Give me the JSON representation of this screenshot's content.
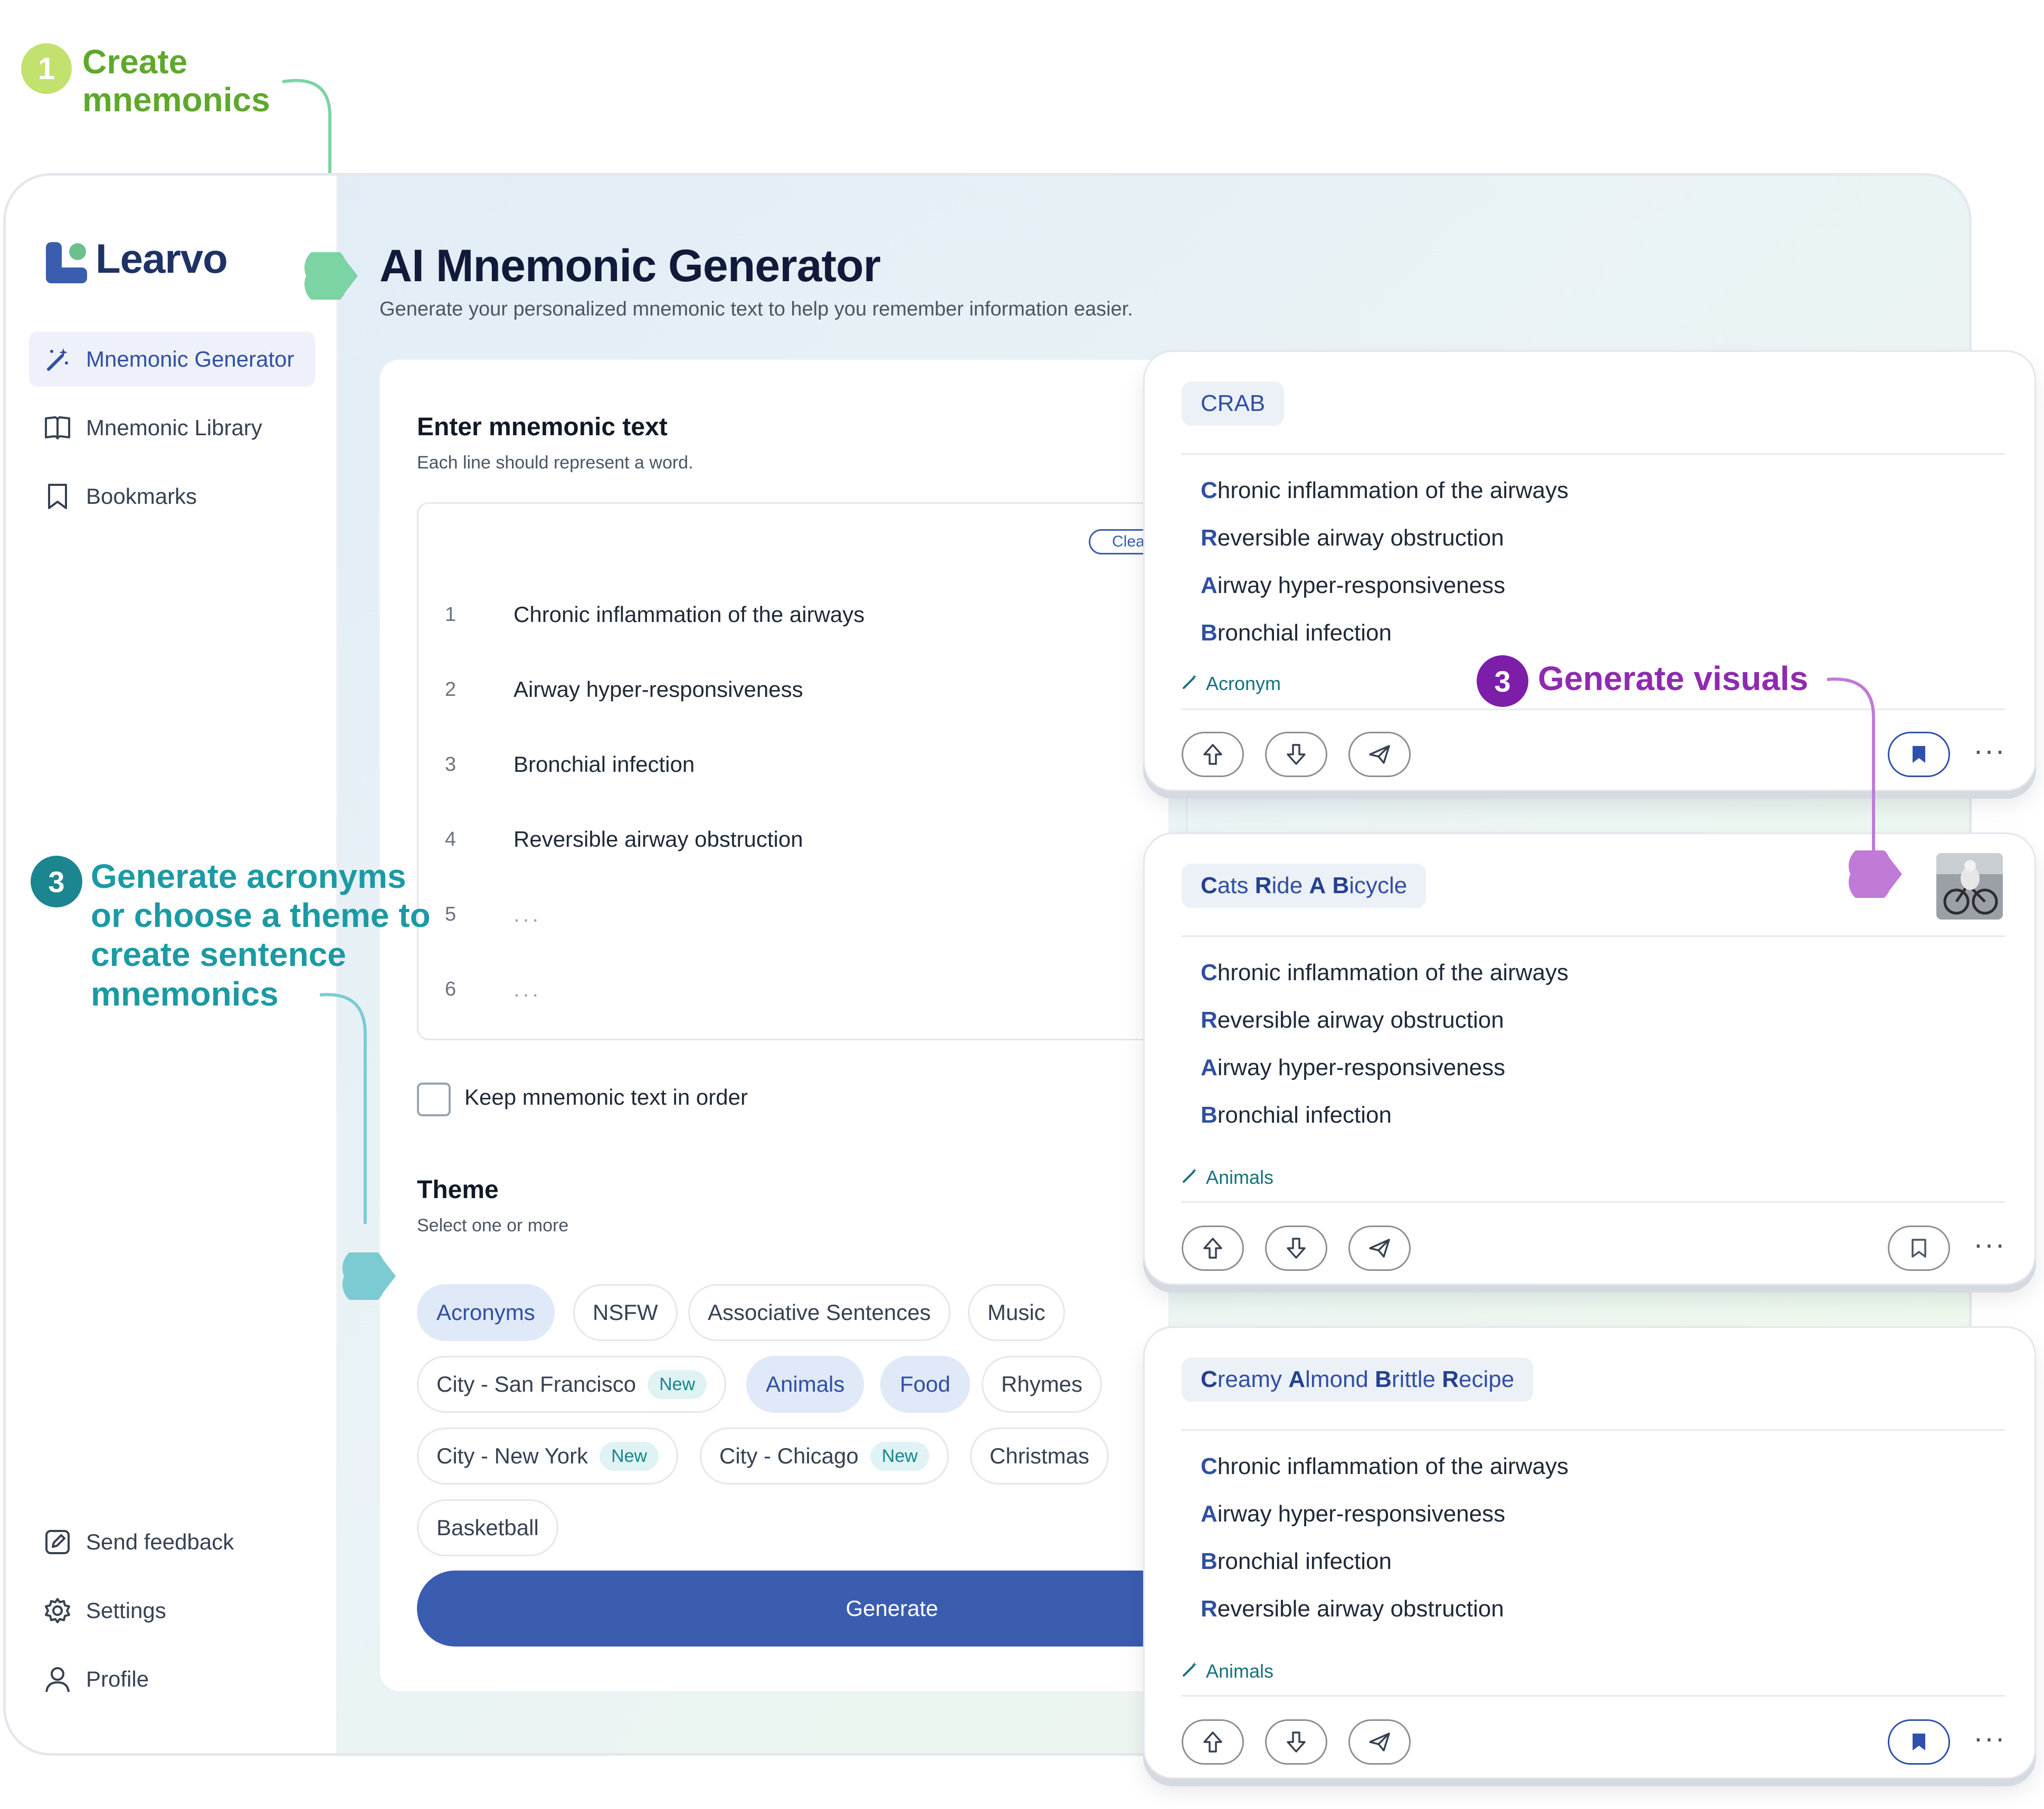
{
  "annotations": {
    "create": {
      "number": "1",
      "text": "Create\nmnemonics",
      "color": "#5fa82c",
      "badge_color": "#c2e16f"
    },
    "acronyms": {
      "number": "3",
      "text": "Generate acronyms\nor choose a theme to\ncreate sentence\nmnemonics",
      "color": "#1c9aa3",
      "badge_color": "#1c8690"
    },
    "visuals": {
      "number": "3",
      "text": "Generate visuals",
      "color": "#8f2ab0",
      "badge_color": "#7c1ea8"
    }
  },
  "brand": {
    "name": "Learvo",
    "accent": "#3b5db0"
  },
  "sidebar": {
    "items": [
      {
        "label": "Mnemonic Generator",
        "icon": "magic-wand-icon",
        "active": true
      },
      {
        "label": "Mnemonic Library",
        "icon": "book-icon",
        "active": false
      },
      {
        "label": "Bookmarks",
        "icon": "bookmark-icon",
        "active": false
      }
    ],
    "bottom": [
      {
        "label": "Send feedback",
        "icon": "edit-icon"
      },
      {
        "label": "Settings",
        "icon": "gear-icon"
      },
      {
        "label": "Profile",
        "icon": "user-icon"
      }
    ]
  },
  "page": {
    "title": "AI Mnemonic Generator",
    "subtitle": "Generate your personalized mnemonic text to help you remember information easier."
  },
  "form": {
    "input_title": "Enter mnemonic text",
    "input_sub": "Each line should represent a word.",
    "clear_label": "Clear",
    "lines": [
      {
        "no": "1",
        "text": "Chronic inflammation of the airways"
      },
      {
        "no": "2",
        "text": "Airway hyper-responsiveness"
      },
      {
        "no": "3",
        "text": "Bronchial infection"
      },
      {
        "no": "4",
        "text": "Reversible airway obstruction"
      },
      {
        "no": "5",
        "text": "..."
      },
      {
        "no": "6",
        "text": "..."
      }
    ],
    "keep_order_label": "Keep mnemonic text in order",
    "theme_title": "Theme",
    "theme_sub": "Select one or more",
    "new_badge": "New",
    "chips": [
      {
        "label": "Acronyms",
        "selected": true
      },
      {
        "label": "NSFW",
        "selected": false
      },
      {
        "label": "Associative Sentences",
        "selected": false
      },
      {
        "label": "Music",
        "selected": false
      },
      {
        "label": "City - San Francisco",
        "selected": false,
        "new": true
      },
      {
        "label": "Animals",
        "selected": true
      },
      {
        "label": "Food",
        "selected": true
      },
      {
        "label": "Rhymes",
        "selected": false
      },
      {
        "label": "City - New York",
        "selected": false,
        "new": true
      },
      {
        "label": "City - Chicago",
        "selected": false,
        "new": true
      },
      {
        "label": "Christmas",
        "selected": false
      },
      {
        "label": "Basketball",
        "selected": false
      }
    ],
    "generate_label": "Generate"
  },
  "results": [
    {
      "title_parts": [
        {
          "b": "",
          "r": "CRAB"
        }
      ],
      "lines": [
        {
          "first": "C",
          "rest": "hronic inflammation of the airways"
        },
        {
          "first": "R",
          "rest": "eversible airway obstruction"
        },
        {
          "first": "A",
          "rest": "irway hyper-responsiveness"
        },
        {
          "first": "B",
          "rest": "ronchial infection"
        }
      ],
      "tag": "Acronym",
      "bookmarked": true
    },
    {
      "title_parts": [
        {
          "b": "C",
          "r": "ats "
        },
        {
          "b": "R",
          "r": "ide "
        },
        {
          "b": "A",
          "r": " "
        },
        {
          "b": "B",
          "r": "icycle"
        }
      ],
      "lines": [
        {
          "first": "C",
          "rest": "hronic inflammation of the airways"
        },
        {
          "first": "R",
          "rest": "eversible airway obstruction"
        },
        {
          "first": "A",
          "rest": "irway hyper-responsiveness"
        },
        {
          "first": "B",
          "rest": "ronchial infection"
        }
      ],
      "tag": "Animals",
      "bookmarked": false,
      "has_image": true
    },
    {
      "title_parts": [
        {
          "b": "C",
          "r": "reamy "
        },
        {
          "b": "A",
          "r": "lmond "
        },
        {
          "b": "B",
          "r": "rittle "
        },
        {
          "b": "R",
          "r": "ecipe"
        }
      ],
      "lines": [
        {
          "first": "C",
          "rest": "hronic inflammation of the airways"
        },
        {
          "first": "A",
          "rest": "irway hyper-responsiveness"
        },
        {
          "first": "B",
          "rest": "ronchial infection"
        },
        {
          "first": "R",
          "rest": "eversible airway obstruction"
        }
      ],
      "tag": "Animals",
      "bookmarked": true
    }
  ]
}
